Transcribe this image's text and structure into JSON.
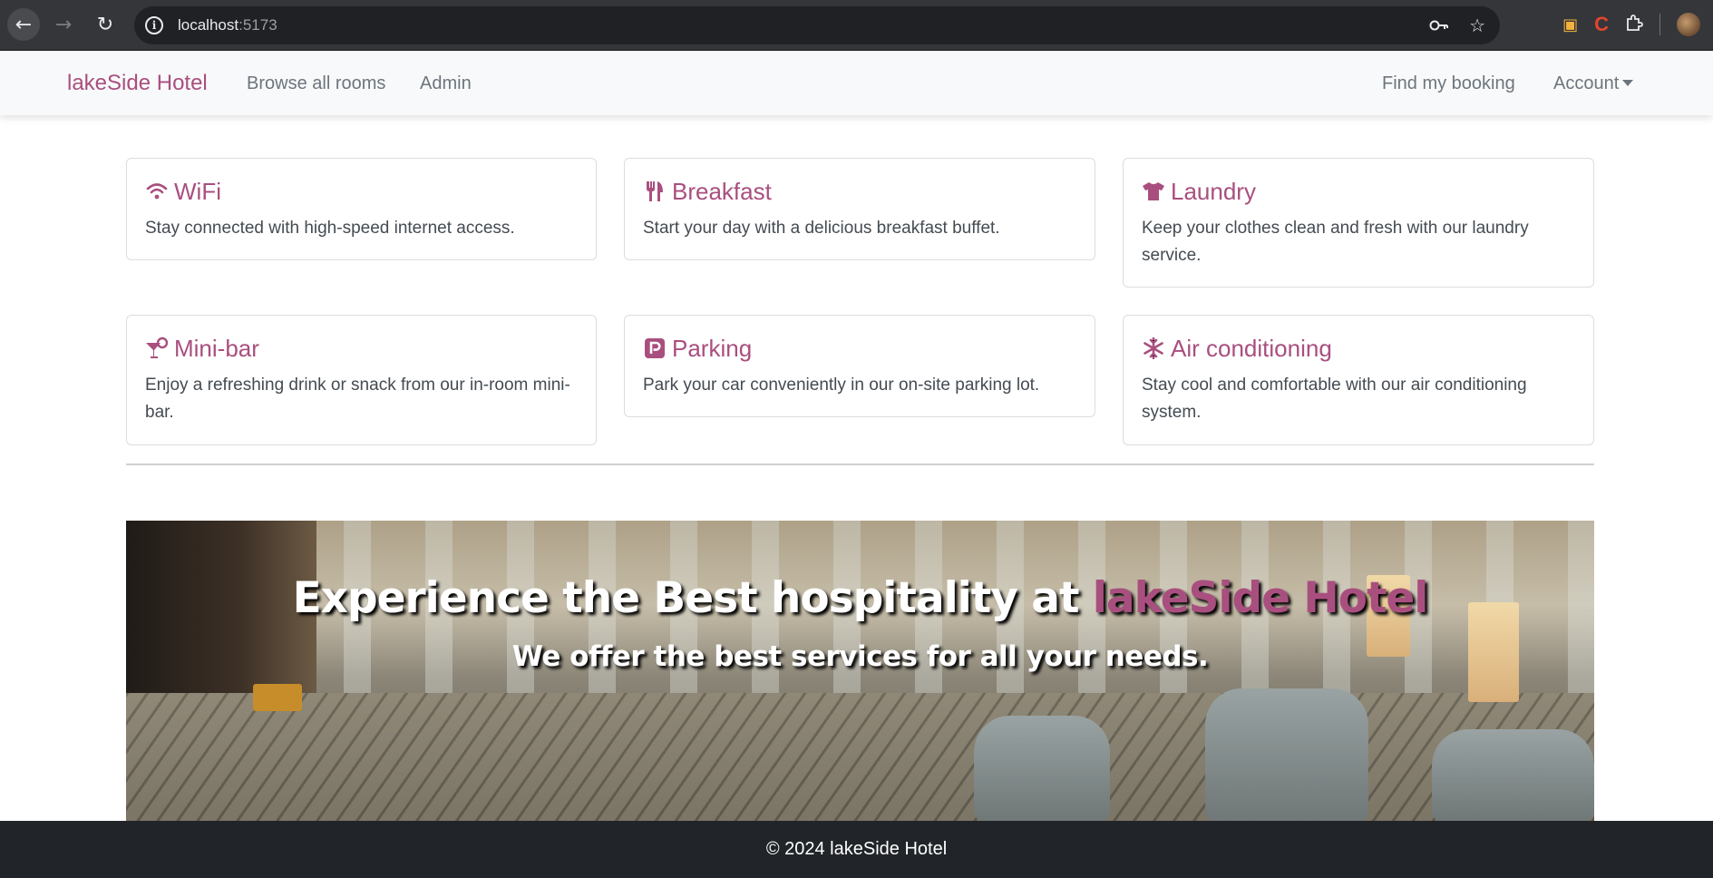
{
  "browser": {
    "url_host": "localhost",
    "url_port": ":5173",
    "icons": [
      "back-icon",
      "forward-icon",
      "reload-icon",
      "site-info-icon",
      "key-icon",
      "star-icon",
      "extension-icon",
      "profile-avatar"
    ]
  },
  "navbar": {
    "brand": "lakeSide Hotel",
    "links": {
      "rooms": "Browse all rooms",
      "admin": "Admin",
      "find": "Find my booking",
      "account": "Account"
    }
  },
  "services": [
    {
      "title": "WiFi",
      "icon": "wifi-icon",
      "text": "Stay connected with high-speed internet access."
    },
    {
      "title": "Breakfast",
      "icon": "utensils-icon",
      "text": "Start your day with a delicious breakfast buffet."
    },
    {
      "title": "Laundry",
      "icon": "tshirt-icon",
      "text": "Keep your clothes clean and fresh with our laundry service."
    },
    {
      "title": "Mini-bar",
      "icon": "cocktail-icon",
      "text": "Enjoy a refreshing drink or snack from our in-room mini-bar."
    },
    {
      "title": "Parking",
      "icon": "parking-icon",
      "text": "Park your car conveniently in our on-site parking lot."
    },
    {
      "title": "Air conditioning",
      "icon": "snowflake-icon",
      "text": "Stay cool and comfortable with our air conditioning system."
    }
  ],
  "hero": {
    "headline_prefix": "Experience the Best hospitality at ",
    "headline_accent": "lakeSide Hotel",
    "subheadline": "We offer the best services for all your needs."
  },
  "footer": {
    "text": "© 2024 lakeSide Hotel"
  },
  "colors": {
    "brand": "#a94f7f",
    "footer_bg": "#212529",
    "navbar_bg": "#f8f9fa"
  }
}
